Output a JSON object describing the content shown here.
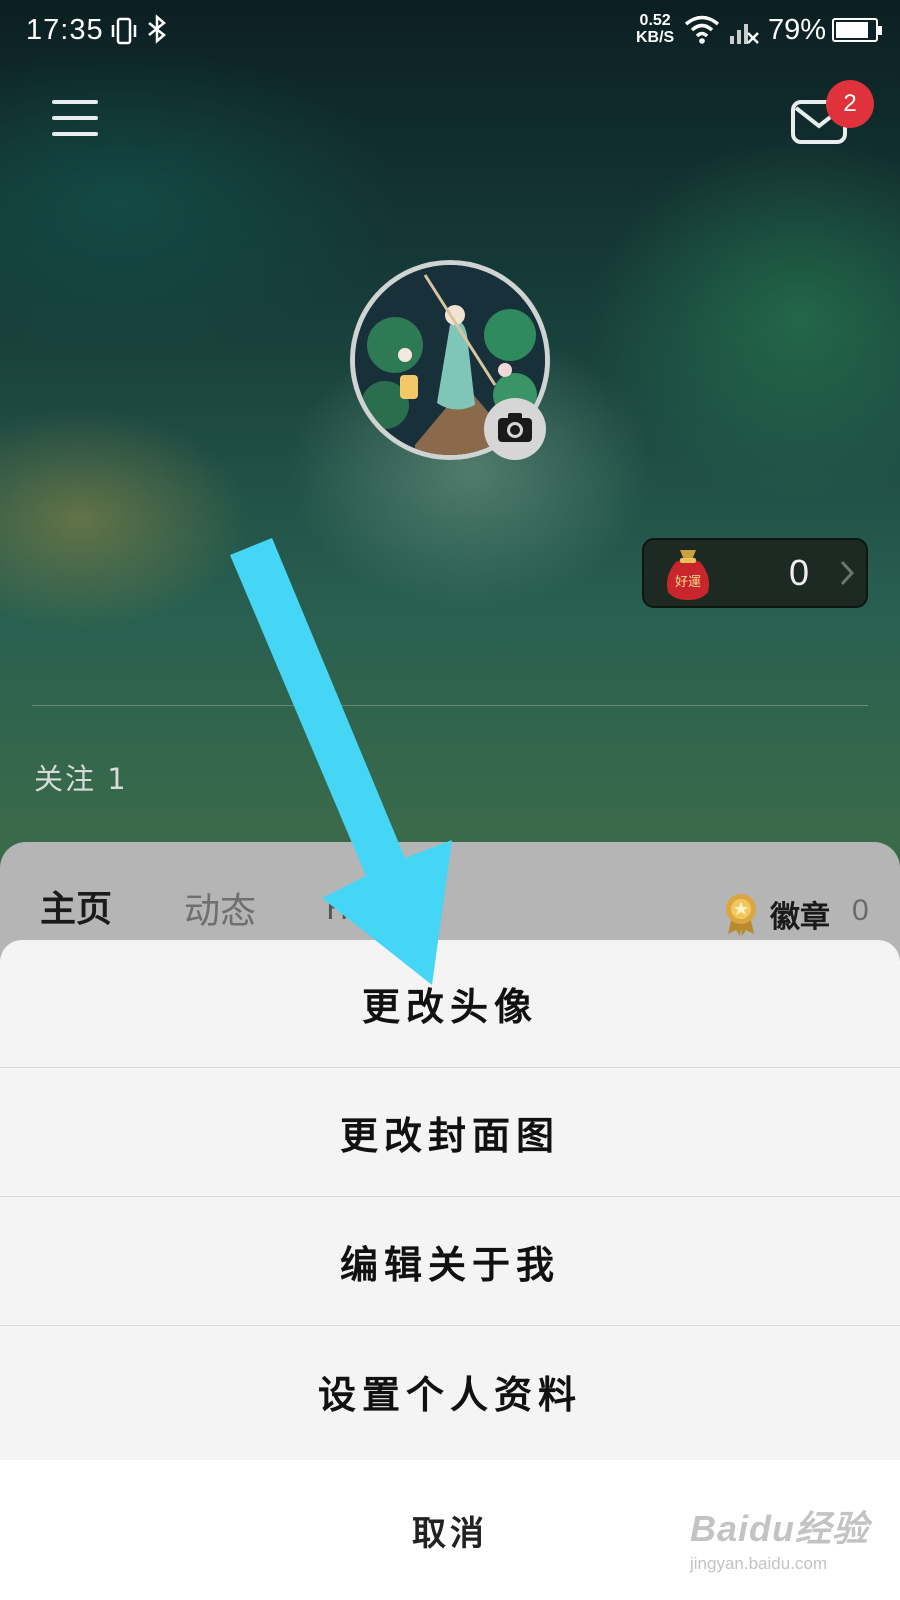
{
  "status_bar": {
    "time": "17:35",
    "net_speed_value": "0.52",
    "net_speed_unit": "KB/S",
    "battery": "79%"
  },
  "header": {
    "menu_icon": "hamburger-menu-icon",
    "mail_icon": "mail-icon",
    "unread_count": "2"
  },
  "profile": {
    "avatar": "avatar-image",
    "camera_icon": "camera-icon",
    "luck": {
      "icon": "lucky-bag-icon",
      "bag_text": "好運",
      "value": "0"
    },
    "follow_text": "关注 1"
  },
  "tabs": {
    "items": [
      {
        "label": "主页"
      },
      {
        "label": "动态"
      }
    ],
    "partial_tab": "H",
    "badge": {
      "icon": "medal-icon",
      "label": "徽章",
      "count": "0"
    }
  },
  "action_sheet": {
    "options": [
      {
        "label": "更改头像"
      },
      {
        "label": "更改封面图"
      },
      {
        "label": "编辑关于我"
      },
      {
        "label": "设置个人资料"
      }
    ],
    "cancel_label": "取消"
  },
  "annotation": {
    "arrow_color": "#45d6f5"
  },
  "watermark": {
    "main": "Baidu经验",
    "sub": "jingyan.baidu.com"
  },
  "colors": {
    "badge_red": "#e0323a",
    "sheet_bg": "#f4f4f4"
  }
}
